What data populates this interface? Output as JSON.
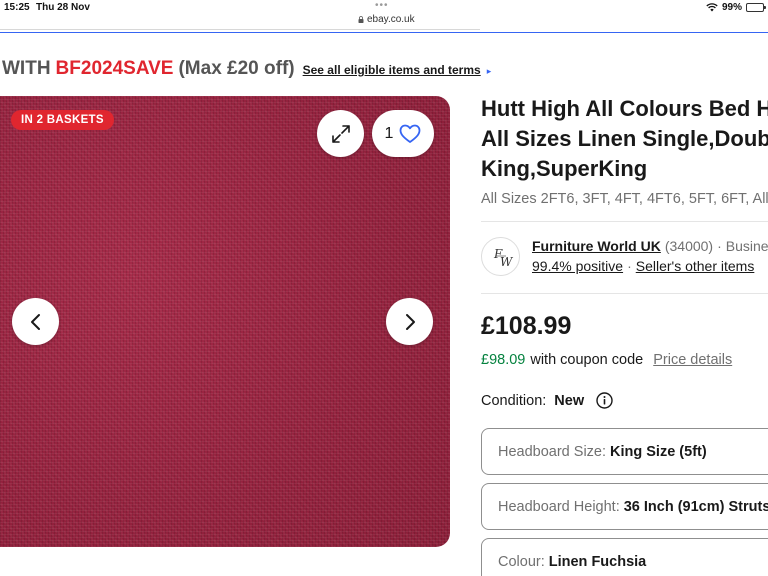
{
  "status_bar": {
    "time": "15:25",
    "date": "Thu 28 Nov",
    "url": "ebay.co.uk",
    "battery": "99%",
    "dots": "•••"
  },
  "promo": {
    "prefix": "WITH",
    "code": "BF2024SAVE",
    "max": "(Max £20 off)",
    "link": "See all eligible items and terms",
    "arrow": "▸"
  },
  "image": {
    "badge": "IN 2 BASKETS",
    "watch_count": "1",
    "fabric_color": "#9a2340"
  },
  "listing": {
    "title_lines": [
      "Hutt High All Colours Bed H",
      "All Sizes Linen Single,Doub",
      "King,SuperKing"
    ],
    "subtitle": "All Sizes 2FT6, 3FT, 4FT, 4FT6, 5FT, 6FT, All"
  },
  "seller": {
    "avatar_text": "FW",
    "name": "Furniture World UK",
    "count": "(34000)",
    "separator": "·",
    "type": "Busine",
    "positive": "99.4% positive",
    "other_items": "Seller's other items"
  },
  "pricing": {
    "price": "£108.99",
    "coupon_price": "£98.09",
    "coupon_text": "with coupon code",
    "price_details": "Price details"
  },
  "condition": {
    "label": "Condition:",
    "value": "New"
  },
  "options": [
    {
      "label": "Headboard Size:",
      "value": "King Size (5ft)"
    },
    {
      "label": "Headboard Height:",
      "value": "36 Inch (91cm) Struts"
    },
    {
      "label": "Colour:",
      "value": "Linen Fuchsia"
    }
  ],
  "colors": {
    "accent_blue": "#3665f3",
    "promo_red": "#e0262f",
    "coupon_green": "#05823f"
  }
}
